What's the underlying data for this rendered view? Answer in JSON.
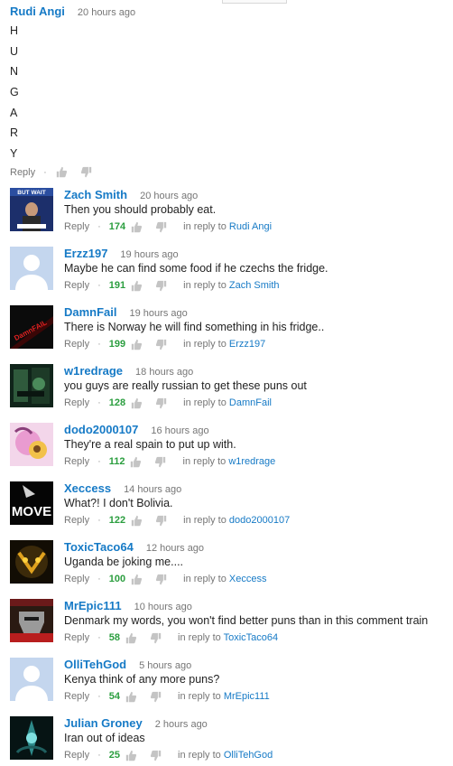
{
  "top_comment": {
    "author": "Rudi Angi",
    "time": "20 hours ago",
    "letters": [
      "H",
      "U",
      "N",
      "G",
      "A",
      "R",
      "Y"
    ],
    "reply_label": "Reply"
  },
  "labels": {
    "in_reply_to": "in reply to"
  },
  "replies": [
    {
      "author": "Zach Smith",
      "time": "20 hours ago",
      "text": "Then you should probably eat.",
      "reply_label": "Reply",
      "likes": "174",
      "reply_to": "Rudi Angi",
      "avatar_text": "BUT WAIT"
    },
    {
      "author": "Erzz197",
      "time": "19 hours ago",
      "text": "Maybe he can find some food if he czechs the fridge.",
      "reply_label": "Reply",
      "likes": "191",
      "reply_to": "Zach Smith"
    },
    {
      "author": "DamnFail",
      "time": "19 hours ago",
      "text": "There is Norway he will find something in his fridge..",
      "reply_label": "Reply",
      "likes": "199",
      "reply_to": "Erzz197",
      "avatar_text": "DamnFAIL"
    },
    {
      "author": "w1redrage",
      "time": "18 hours ago",
      "text": "you guys are really russian to get these puns out",
      "reply_label": "Reply",
      "likes": "128",
      "reply_to": "DamnFail"
    },
    {
      "author": "dodo2000107",
      "time": "16 hours ago",
      "text": "They're a real spain to put up with.",
      "reply_label": "Reply",
      "likes": "112",
      "reply_to": "w1redrage"
    },
    {
      "author": "Xeccess",
      "time": "14 hours ago",
      "text": "What?! I don't Bolivia.",
      "reply_label": "Reply",
      "likes": "122",
      "reply_to": "dodo2000107",
      "avatar_text": "MOVE"
    },
    {
      "author": "ToxicTaco64",
      "time": "12 hours ago",
      "text": "Uganda be joking me....",
      "reply_label": "Reply",
      "likes": "100",
      "reply_to": "Xeccess"
    },
    {
      "author": "MrEpic111",
      "time": "10 hours ago",
      "text": "Denmark my words, you won't find better puns than in this comment train",
      "reply_label": "Reply",
      "likes": "58",
      "reply_to": "ToxicTaco64"
    },
    {
      "author": "OlliTehGod",
      "time": "5 hours ago",
      "text": "Kenya think of any more puns?",
      "reply_label": "Reply",
      "likes": "54",
      "reply_to": "MrEpic111"
    },
    {
      "author": "Julian Groney",
      "time": "2 hours ago",
      "text": "Iran out of ideas",
      "reply_label": "Reply",
      "likes": "25",
      "reply_to": "OlliTehGod"
    }
  ]
}
